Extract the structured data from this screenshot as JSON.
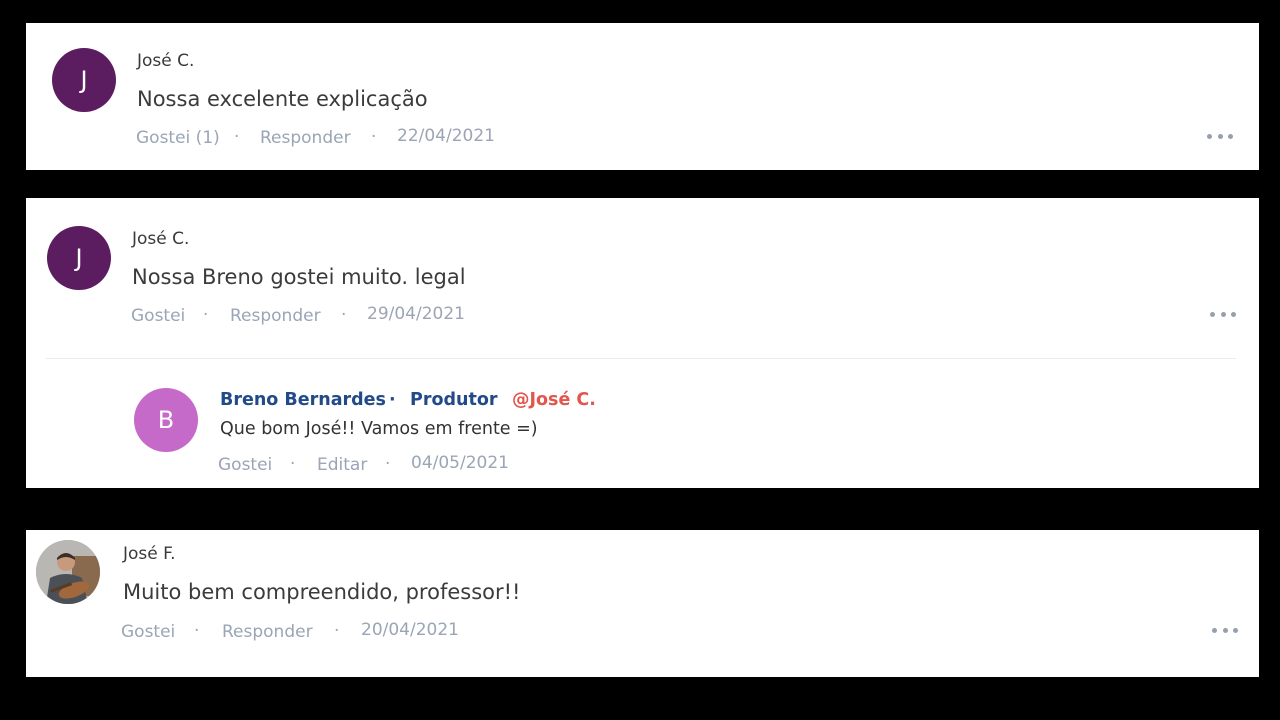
{
  "comments": [
    {
      "avatar_initial": "J",
      "author": "José C.",
      "text": "Nossa excelente explicação",
      "like_label": "Gostei (1)",
      "reply_label": "Responder",
      "date": "22/04/2021",
      "separator": "·"
    },
    {
      "avatar_initial": "J",
      "author": "José C.",
      "text": "Nossa Breno gostei muito. legal",
      "like_label": "Gostei",
      "reply_label": "Responder",
      "date": "29/04/2021",
      "separator": "·",
      "reply": {
        "avatar_initial": "B",
        "author": "Breno Bernardes",
        "separator": "·",
        "role": "Produtor",
        "mention": "@José C.",
        "text": "Que bom José!! Vamos em frente =)",
        "like_label": "Gostei",
        "edit_label": "Editar",
        "date": "04/05/2021"
      }
    },
    {
      "author": "José F.",
      "text": "Muito bem compreendido, professor!!",
      "like_label": "Gostei",
      "reply_label": "Responder",
      "date": "20/04/2021",
      "separator": "·"
    }
  ],
  "colors": {
    "avatar_j": "#5c1c60",
    "avatar_b": "#c66ac9",
    "meta_text": "#9aa5b5",
    "reply_name": "#234a88",
    "mention": "#e2564c"
  },
  "icons": {
    "more": "more-options-icon"
  }
}
